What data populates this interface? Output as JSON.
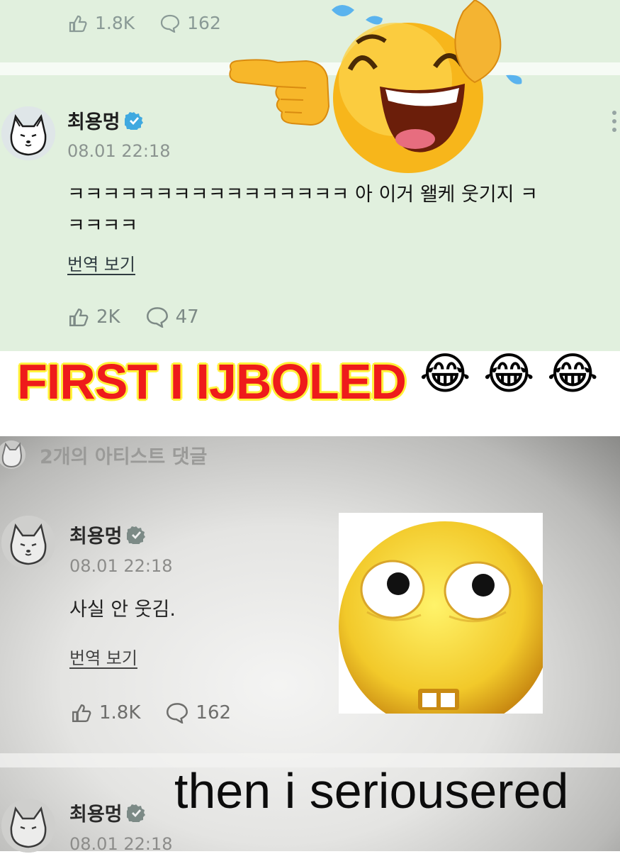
{
  "top": {
    "prev_stats": {
      "likes": "1.8K",
      "replies": "162"
    },
    "comment": {
      "author": "최용멍",
      "timestamp": "08.01 22:18",
      "text_line1": "ㅋㅋㅋㅋㅋㅋㅋㅋㅋㅋㅋㅋㅋㅋㅋㅋ 아 이거 왤케 웃기지 ㅋ",
      "text_line2": "ㅋㅋㅋㅋ",
      "translate_label": "번역 보기",
      "likes": "2K",
      "replies": "47"
    }
  },
  "captions": {
    "first": "FIRST I IJBOLED",
    "first_emoji": "😂",
    "then": "then i seriousered"
  },
  "bottom": {
    "artist_comments_label": "2개의 아티스트 댓글",
    "comment": {
      "author": "최용멍",
      "timestamp": "08.01 22:18",
      "text": "사실 안 웃김.",
      "translate_label": "번역 보기",
      "likes": "1.8K",
      "replies": "162"
    },
    "next_comment": {
      "author": "최용멍",
      "timestamp": "08.01 22:18"
    }
  },
  "colors": {
    "top_bg": "#e1f0de",
    "verified": "#3fa9e0",
    "caption_red": "#ee1b1b",
    "caption_yellow_outline": "#fff23a"
  },
  "icons": [
    "like-icon",
    "reply-icon",
    "verified-badge-icon",
    "more-options-icon",
    "dog-avatar-icon",
    "laughing-emoji-icon",
    "pointing-hand-icon",
    "wide-eyed-emoji-icon"
  ]
}
